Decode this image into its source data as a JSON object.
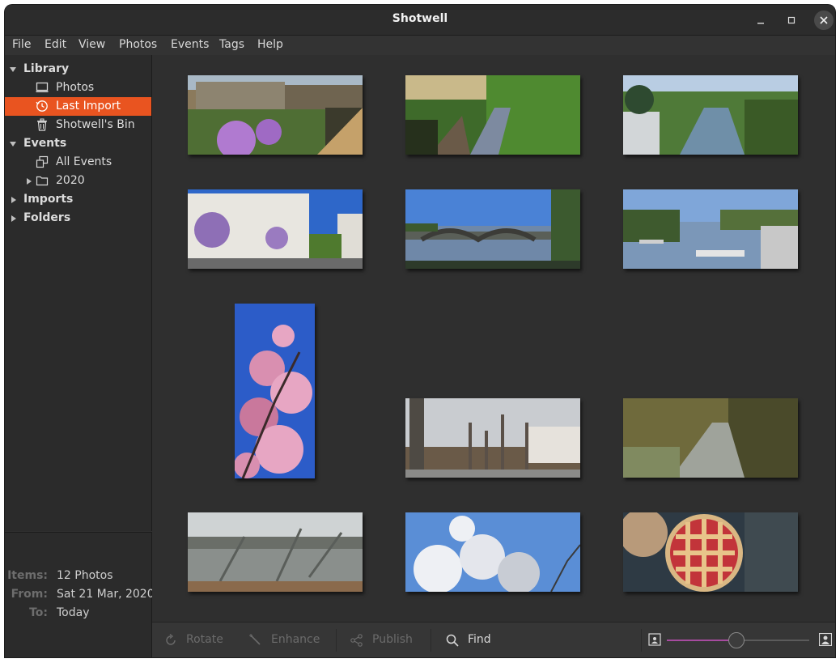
{
  "window": {
    "title": "Shotwell"
  },
  "menu": [
    "File",
    "Edit",
    "View",
    "Photos",
    "Events",
    "Tags",
    "Help"
  ],
  "sidebar": {
    "library": "Library",
    "photos": "Photos",
    "last_import": "Last Import",
    "bin": "Shotwell's Bin",
    "events": "Events",
    "all_events": "All Events",
    "year_2020": "2020",
    "imports": "Imports",
    "folders": "Folders"
  },
  "info": {
    "items_key": "Items:",
    "items_val": "12 Photos",
    "from_key": "From:",
    "from_val": "Sat 21 Mar, 2020",
    "to_key": "To:",
    "to_val": "Today"
  },
  "photos": [
    {
      "subject": "houses with wisteria and garden",
      "colors": [
        "#8b7a5c",
        "#5d7a3c",
        "#b07ad0",
        "#3b3a2c"
      ]
    },
    {
      "subject": "canal at sunset",
      "colors": [
        "#c9b98a",
        "#3e6a2a",
        "#6a8a42",
        "#26301c"
      ]
    },
    {
      "subject": "river with fence and trees",
      "colors": [
        "#8fb2d8",
        "#4f7a38",
        "#2e4a30",
        "#b8c3c8"
      ]
    },
    {
      "subject": "white terraced houses with wisteria",
      "colors": [
        "#2e67c9",
        "#e8e6e0",
        "#8e6fb6",
        "#4f7a2e"
      ]
    },
    {
      "subject": "river bridge",
      "colors": [
        "#4a82d6",
        "#3c5a2f",
        "#6f88a8",
        "#2d3a2a"
      ]
    },
    {
      "subject": "river with boats",
      "colors": [
        "#7fa6d9",
        "#3e5a2e",
        "#7b97b8",
        "#c8c8c8"
      ]
    },
    {
      "subject": "pink blossom",
      "colors": [
        "#2c5cc8",
        "#e7a6c3",
        "#c9789c",
        "#3a2a2a"
      ]
    },
    {
      "subject": "street with pollarded trees",
      "colors": [
        "#c9ccd0",
        "#4e4a44",
        "#8a7d70",
        "#6a5a48"
      ]
    },
    {
      "subject": "stream in woodland",
      "colors": [
        "#6f6a3c",
        "#9fa39b",
        "#4a4a2a",
        "#808a60"
      ]
    },
    {
      "subject": "flooded trees",
      "colors": [
        "#cfd3d4",
        "#5a5e5a",
        "#8a8f8c",
        "#8a6a4c"
      ]
    },
    {
      "subject": "white blossom",
      "colors": [
        "#5a8ed6",
        "#eef0f4",
        "#c8ccd4",
        "#3a3a3a"
      ]
    },
    {
      "subject": "lattice pie",
      "colors": [
        "#2e3a44",
        "#e8c48a",
        "#c2343a",
        "#b89a7a"
      ]
    }
  ],
  "toolbar": {
    "rotate": "Rotate",
    "enhance": "Enhance",
    "publish": "Publish",
    "find": "Find",
    "zoom_level": 0.49
  },
  "colors": {
    "accent": "#e95420",
    "background": "#2f2f2f"
  }
}
